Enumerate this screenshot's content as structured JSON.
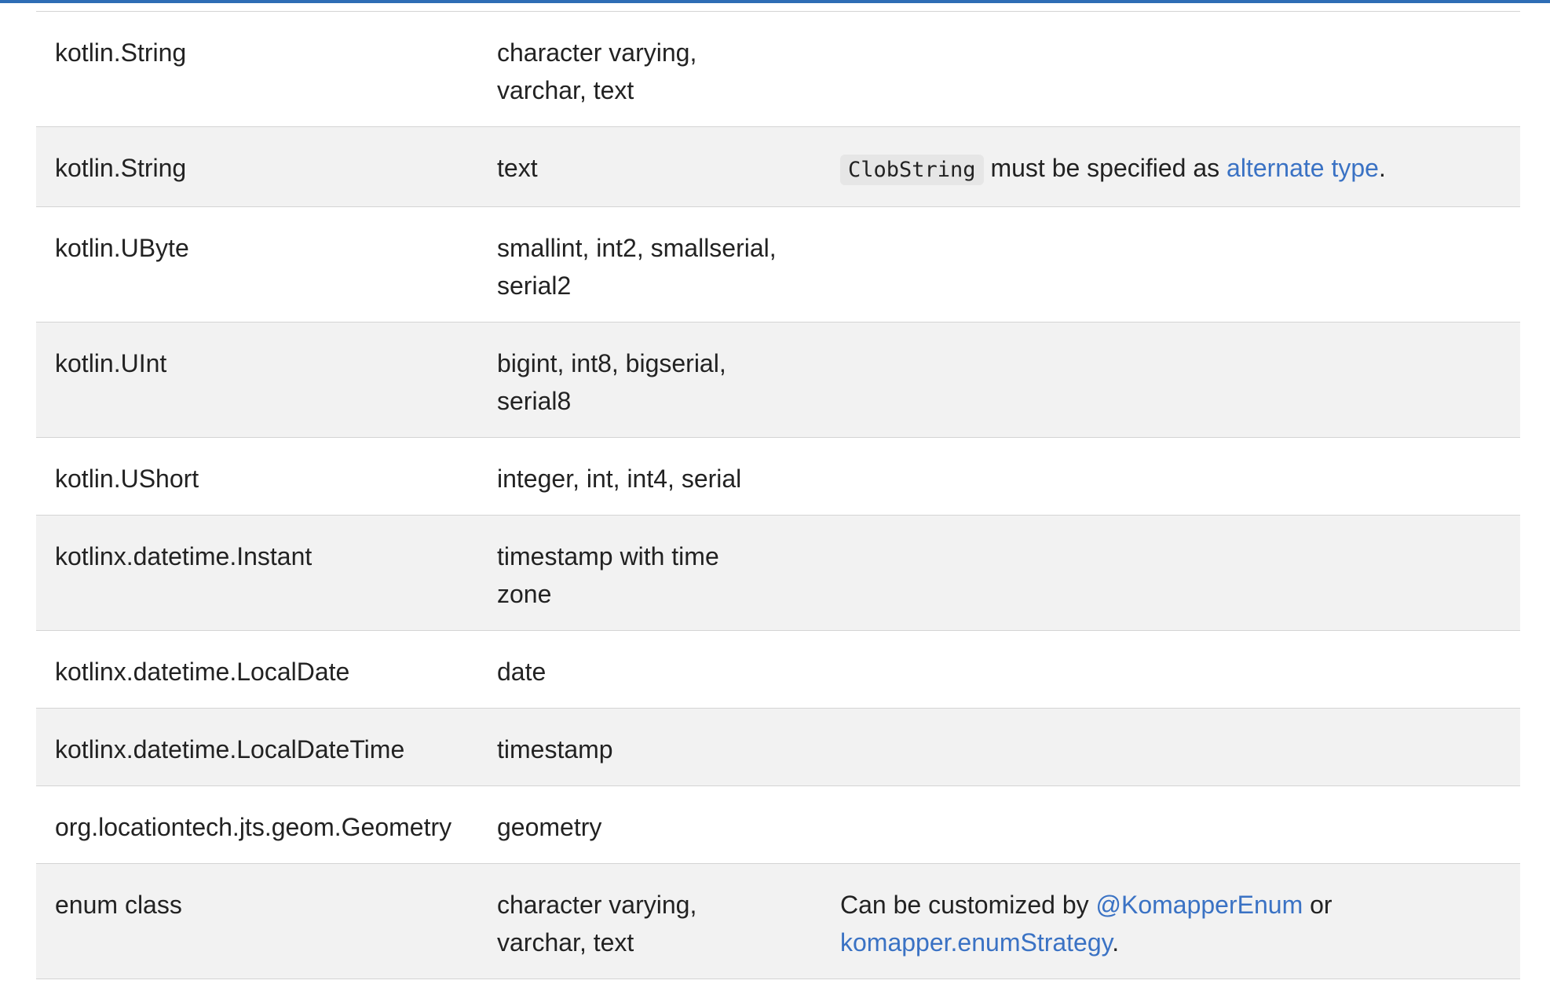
{
  "rows": [
    {
      "kotlin": "kotlin.String",
      "sql": [
        "character varying,",
        "varchar, text"
      ],
      "note": null
    },
    {
      "kotlin": "kotlin.String",
      "sql": [
        "text"
      ],
      "note": {
        "code": "ClobString",
        "text": " must be specified as ",
        "link": "alternate type",
        "end": "."
      }
    },
    {
      "kotlin": "kotlin.UByte",
      "sql": [
        "smallint, int2, smallserial,",
        "serial2"
      ],
      "note": null
    },
    {
      "kotlin": "kotlin.UInt",
      "sql": [
        "bigint, int8, bigserial,",
        "serial8"
      ],
      "note": null
    },
    {
      "kotlin": "kotlin.UShort",
      "sql": [
        "integer, int, int4, serial"
      ],
      "note": null
    },
    {
      "kotlin": "kotlinx.datetime.Instant",
      "sql": [
        "timestamp with time",
        "zone"
      ],
      "note": null
    },
    {
      "kotlin": "kotlinx.datetime.LocalDate",
      "sql": [
        "date"
      ],
      "note": null
    },
    {
      "kotlin": "kotlinx.datetime.LocalDateTime",
      "sql": [
        "timestamp"
      ],
      "note": null
    },
    {
      "kotlin": "org.locationtech.jts.geom.Geometry",
      "sql": [
        "geometry"
      ],
      "note": null
    },
    {
      "kotlin": "enum class",
      "sql": [
        "character varying,",
        "varchar, text"
      ],
      "note": {
        "text1": "Can be customized by ",
        "link1": "@KomapperEnum",
        "text2": " or",
        "link2": "komapper.enumStrategy",
        "end": "."
      }
    }
  ]
}
